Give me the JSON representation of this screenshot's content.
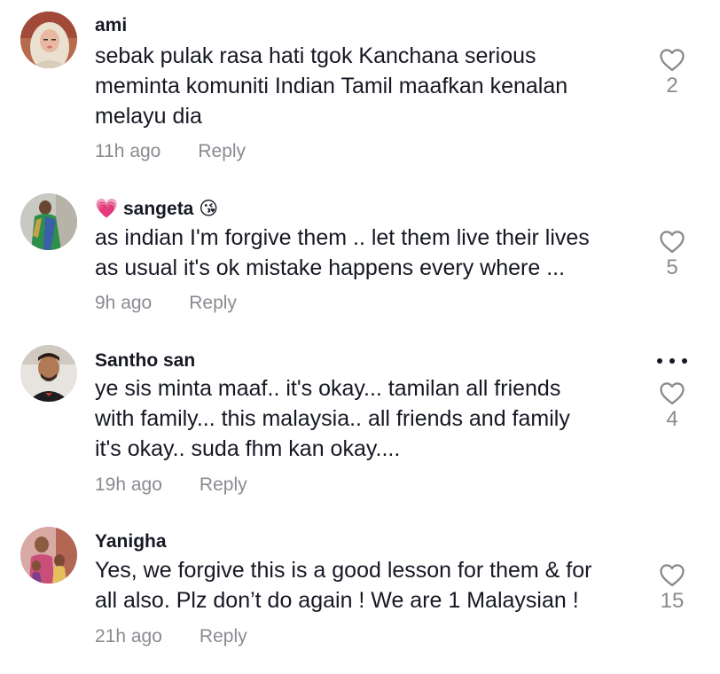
{
  "comments": [
    {
      "username": "ami",
      "username_prefix": "",
      "username_suffix": "",
      "text_lines": [
        "sebak pulak rasa hati tgok Kanchana serious",
        "meminta komuniti Indian Tamil maafkan kenalan",
        "melayu dia"
      ],
      "time": "11h ago",
      "reply_label": "Reply",
      "likes": "2",
      "avatar_icon": "hijab-woman-avatar"
    },
    {
      "username": "sangeta",
      "username_prefix": "💗",
      "username_suffix": "😘",
      "text_lines": [
        "as indian I'm forgive them .. let them live their lives",
        "as usual it's ok mistake happens every where ..."
      ],
      "time": "9h ago",
      "reply_label": "Reply",
      "likes": "5",
      "avatar_icon": "saree-woman-avatar"
    },
    {
      "username": "Santho san",
      "username_prefix": "",
      "username_suffix": "",
      "text_lines": [
        "ye sis minta maaf.. it's okay... tamilan all friends",
        "with family... this malaysia.. all friends and family",
        "it's okay.. suda fhm kan okay...."
      ],
      "time": "19h ago",
      "reply_label": "Reply",
      "likes": "4",
      "avatar_icon": "man-avatar",
      "has_more_menu": true
    },
    {
      "username": "Yanigha",
      "username_prefix": "",
      "username_suffix": "",
      "text_lines": [
        "Yes, we forgive this is a good lesson for them & for",
        "all also. Plz don’t do again ! We are 1 Malaysian !"
      ],
      "time": "21h ago",
      "reply_label": "Reply",
      "likes": "15",
      "avatar_icon": "family-avatar"
    }
  ],
  "colors": {
    "text": "#161823",
    "muted": "#8a8b91",
    "background": "#ffffff"
  }
}
